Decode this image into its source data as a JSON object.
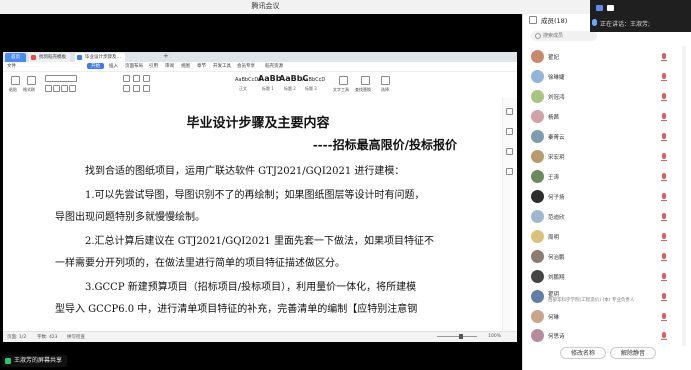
{
  "window": {
    "title": "腾讯会议"
  },
  "speaker": {
    "label": "正在讲话：王淑芳;"
  },
  "doc_app": {
    "tabs": [
      "首页",
      "找到稻壳模板",
      "毕业设计步骤及…"
    ],
    "menu": [
      "文件",
      "开始",
      "插入",
      "页面布局",
      "引用",
      "审阅",
      "视图",
      "章节",
      "开发工具",
      "会员专享",
      "稻壳资源"
    ],
    "ribbon": {
      "paste": "粘贴",
      "format_painter": "格式刷",
      "styles": [
        "AaBbCcDd",
        "AaBb",
        "AaBbC",
        "AaBbCcD"
      ],
      "style_names": [
        "正文",
        "标题 1",
        "标题 2",
        "标题 3"
      ],
      "text_tool": "文字工具",
      "find_replace": "查找替换",
      "select": "选择"
    },
    "status": {
      "pages": "页面: 1/2",
      "words": "字数: 423",
      "spell": "拼写检查",
      "zoom": "100%"
    }
  },
  "document": {
    "title": "毕业设计步骤及主要内容",
    "subtitle": "----招标最高限价/投标报价",
    "paragraphs": [
      "找到合适的图纸项目，运用广联达软件 GTJ2021/GQI2021 进行建模：",
      "1.可以先尝试导图，导图识别不了的再绘制；如果图纸图层等设计时有问题，",
      "导图出现问题特别多就慢慢绘制。",
      "2.汇总计算后建议在 GTJ2021/GQI2021 里面先套一下做法，如果项目特征不",
      "一样需要分开列项的，在做法里进行简单的项目特征描述做区分。",
      "3.GCCP 新建预算项目（招标项目/投标项目），利用量价一体化，将所建模",
      "型导入 GCCP6.0 中，进行清单项目特征的补充，完善清单的编制【应特别注意钢"
    ]
  },
  "share_label": "王淑芳的屏幕共享",
  "panel": {
    "title": "成员(18)",
    "search_placeholder": "搜索成员",
    "members": [
      {
        "name": "翟妃",
        "color": "#c98a6b"
      },
      {
        "name": "徐琳婕",
        "color": "#8fb5d9"
      },
      {
        "name": "刘冠鸿",
        "color": "#a7c480"
      },
      {
        "name": "杨茜",
        "color": "#d1a2a8"
      },
      {
        "name": "秦菁云",
        "color": "#7c9db0"
      },
      {
        "name": "宋宏玥",
        "color": "#b89a6f"
      },
      {
        "name": "王涛",
        "color": "#6d8a5c"
      },
      {
        "name": "何子扬",
        "color": "#2c2c2c"
      },
      {
        "name": "范迪欣",
        "color": "#9fb7cf"
      },
      {
        "name": "周明",
        "color": "#d9c27a"
      },
      {
        "name": "何治鹏",
        "color": "#8a7c6e"
      },
      {
        "name": "刘鹏翔",
        "color": "#444444"
      },
      {
        "name": "翟玥",
        "color": "#5f7fa8",
        "title": "西部华科学学院(工程造价) (本) 专业负责人"
      },
      {
        "name": "何琳",
        "color": "#caa58a"
      },
      {
        "name": "何思诗",
        "color": "#b58c9b"
      }
    ],
    "buttons": {
      "rename": "修改名称",
      "unmute": "解除静音"
    }
  }
}
